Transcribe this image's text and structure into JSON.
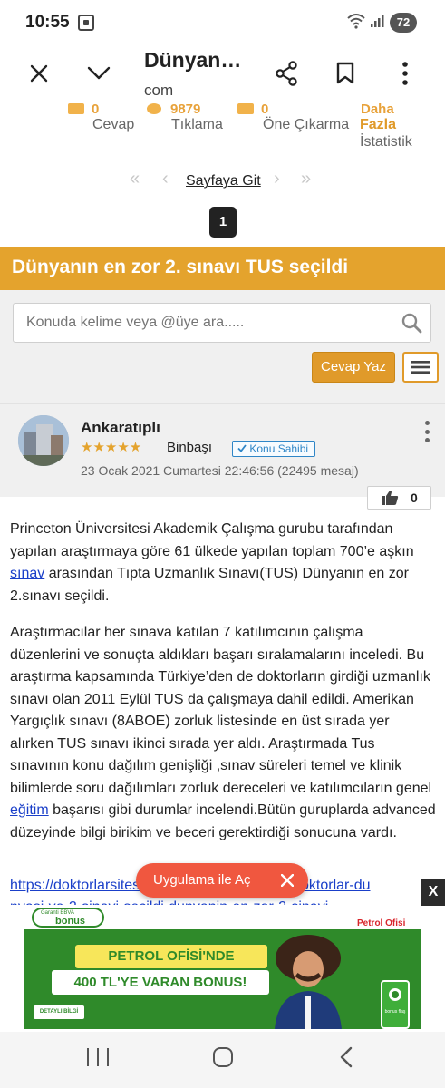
{
  "statusbar": {
    "time": "10:55",
    "battery": "72"
  },
  "toolbar": {
    "title": "Dünyan…",
    "url": "com"
  },
  "stats": [
    {
      "value": "0",
      "label": "Cevap"
    },
    {
      "value": "9879",
      "label": "Tıklama"
    },
    {
      "value": "0",
      "label": "Öne Çıkarma"
    },
    {
      "value": "Daha",
      "label": "Fazla",
      "label2": "İstatistik"
    }
  ],
  "pager": {
    "goto_label": "Sayfaya Git",
    "current_page": "1"
  },
  "topic": {
    "title": "Dünyanın en zor 2. sınavı TUS seçildi"
  },
  "search": {
    "placeholder": "Konuda kelime veya @üye ara....."
  },
  "actions": {
    "reply_label": "Cevap Yaz"
  },
  "post": {
    "author": "Ankaratıplı",
    "stars": "★★★★★",
    "rank": "Binbaşı",
    "owner_badge": "Konu Sahibi",
    "date": "23 Ocak 2021 Cumartesi 22:46:56 (22495 mesaj)",
    "likes": "0",
    "p1_a": "Princeton Üniversitesi Akademik Çalışma gurubu tarafından yapılan araştırmaya göre 61 ülkede yapılan toplam 700’e aşkın ",
    "p1_link": "sınav",
    "p1_b": " arasından Tıpta Uzmanlık Sınavı(TUS) Dünyanın en zor 2.sınavı seçildi.",
    "p2_a": "Araştırmacılar her sınava katılan 7 katılımcının çalışma düzenlerini ve sonuçta aldıkları başarı sıralamalarını inceledi. Bu araştırma kapsamında Türkiye’den de doktorların girdiği uzmanlık sınavı olan 2011 Eylül TUS da çalışmaya dahil edildi. Amerikan Yargıçlık sınavı (8ABOE) zorluk listesinde en üst sırada yer alırken TUS sınavı ikinci sırada yer aldı. Araştırmada Tus sınavının konu dağılım genişliği ,sınav süreleri temel ve klinik bilimlerde soru dağılımları zorluk dereceleri ve katılımcıların genel ",
    "p2_link": "eğitim",
    "p2_b": " başarısı gibi durumlar incelendi.Bütün guruplarda advanced düzeyinde bilgi birikim ve beceri gerektirdiği sonucuna vardı.",
    "source_link": "https://doktorlarsitesi.com/tip-tus/dunyadaki-doktorlar-du",
    "source_link2": "nyasi-ve-2-sinavi-secildi-dunyanin-en-zor-2-sinavi"
  },
  "floating": {
    "open_app_label": "Uygulama ile Aç"
  },
  "ad": {
    "close_label": "X",
    "bonus_small": "Garanti BBVA",
    "bonus_big": "bonus",
    "brand": "Petrol Ofisi",
    "headline1": "PETROL OFİSİ'NDE",
    "headline2": "400 TL'YE VARAN BONUS!",
    "detail": "DETAYLI BİLGİ",
    "phone_label": "bonus flaş"
  },
  "colors": {
    "accent": "#e4a32d",
    "link": "#1a3fc9",
    "fab": "#f0573f",
    "ad_green": "#2f8a2a"
  }
}
